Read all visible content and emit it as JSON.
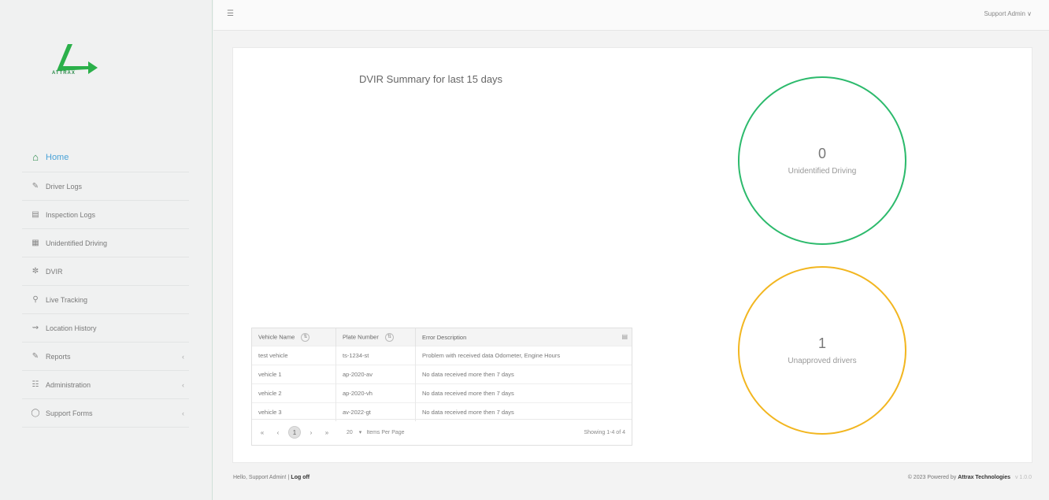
{
  "header": {
    "menu_icon": "hamburger-icon",
    "user_menu_label": "Support Admin ∨"
  },
  "logo": {
    "text": "ATTRAX"
  },
  "sidebar": {
    "items": [
      {
        "label": "Home",
        "icon": "home-icon"
      },
      {
        "label": "Driver Logs",
        "icon": "edit-icon"
      },
      {
        "label": "Inspection Logs",
        "icon": "clipboard-icon"
      },
      {
        "label": "Unidentified Driving",
        "icon": "calendar-icon"
      },
      {
        "label": "DVIR",
        "icon": "wrench-icon"
      },
      {
        "label": "Live Tracking",
        "icon": "pin-icon"
      },
      {
        "label": "Location History",
        "icon": "route-icon"
      },
      {
        "label": "Reports",
        "icon": "report-icon",
        "chevron": "‹"
      },
      {
        "label": "Administration",
        "icon": "admin-icon",
        "chevron": "‹"
      },
      {
        "label": "Support Forms",
        "icon": "forms-icon",
        "chevron": "‹"
      }
    ]
  },
  "main": {
    "title": "DVIR Summary for last 15 days",
    "summary": [
      {
        "value": "0",
        "label": "Unidentified Driving",
        "color": "#2cba6c"
      },
      {
        "value": "1",
        "label": "Unapproved drivers",
        "color": "#f2b620"
      }
    ],
    "table": {
      "columns": [
        "Vehicle Name",
        "Plate Number",
        "Error Description"
      ],
      "rows": [
        [
          "test vehicle",
          "ts-1234-st",
          "Problem with received data Odometer, Engine Hours"
        ],
        [
          "vehicle 1",
          "ap-2020-av",
          "No data received more then 7 days"
        ],
        [
          "vehicle 2",
          "ap-2020-vh",
          "No data received more then 7 days"
        ],
        [
          "vehicle 3",
          "av-2022-gt",
          "No data received more then 7 days"
        ]
      ],
      "pager": {
        "first": "«",
        "prev": "‹",
        "current_page": "1",
        "next": "›",
        "last": "»",
        "page_size": "20",
        "page_size_caret": "▾",
        "page_size_label": "Items Per Page",
        "info": "Showing 1-4 of 4"
      }
    }
  },
  "footer": {
    "left_prefix": "Hello, Support Admin! |",
    "logoff": "Log off",
    "right_text": "© 2023 Powered by",
    "company": "Attrax Technologies",
    "version": "v 1.0.0"
  }
}
